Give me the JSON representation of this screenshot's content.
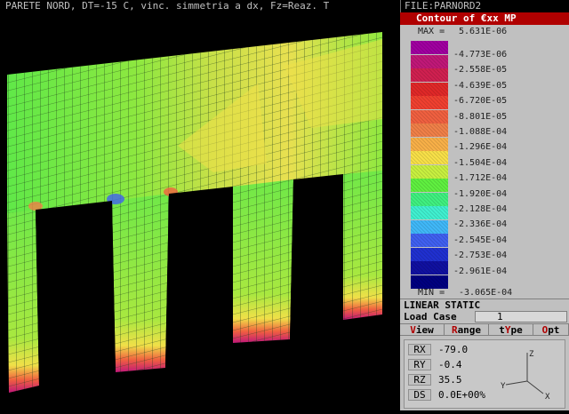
{
  "header": {
    "title": "PARETE NORD, DT=-15 C, vinc. simmetria a dx, Fz=Reaz. T",
    "file": "FILE:PARNORD2"
  },
  "legend": {
    "title": "Contour of €xx MP",
    "max_label": "MAX =",
    "max_value": "5.631E-06",
    "min_label": "MIN =",
    "min_value": "-3.065E-04",
    "levels": [
      "-4.773E-06",
      "-2.558E-05",
      "-4.639E-05",
      "-6.720E-05",
      "-8.801E-05",
      "-1.088E-04",
      "-1.296E-04",
      "-1.504E-04",
      "-1.712E-04",
      "-1.920E-04",
      "-2.128E-04",
      "-2.336E-04",
      "-2.545E-04",
      "-2.753E-04",
      "-2.961E-04"
    ],
    "colors": [
      "#a000a0",
      "#c01878",
      "#d02050",
      "#e02828",
      "#f04030",
      "#f06040",
      "#f08048",
      "#f8b048",
      "#f8e048",
      "#c8f040",
      "#60f040",
      "#40f080",
      "#40f0d0",
      "#40b8f8",
      "#4060f0",
      "#2030d0",
      "#1010a0",
      "#000080"
    ]
  },
  "analysis_type": "LINEAR STATIC",
  "load_case": {
    "label": "Load Case",
    "value": "1"
  },
  "menu": [
    {
      "hot": "V",
      "rest": "iew"
    },
    {
      "hot": "R",
      "rest": "ange"
    },
    {
      "pre": "t",
      "hot": "Y",
      "rest": "pe"
    },
    {
      "hot": "O",
      "rest": "pt"
    }
  ],
  "view_rotation": [
    {
      "key": "RX",
      "value": "-79.0"
    },
    {
      "key": "RY",
      "value": "-0.4"
    },
    {
      "key": "RZ",
      "value": "35.5"
    },
    {
      "key": "DS",
      "value": "0.0E+00%"
    }
  ],
  "axes_triad": {
    "z": "Z",
    "y": "Y",
    "x": "X"
  },
  "icons": {
    "axes": "axes-triad-icon"
  }
}
